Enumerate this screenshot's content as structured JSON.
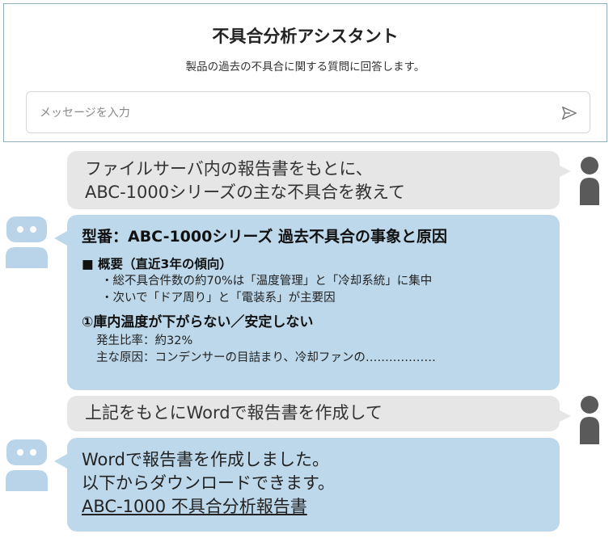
{
  "header": {
    "title": "不具合分析アシスタント",
    "subtitle": "製品の過去の不具合に関する質問に回答します。"
  },
  "input": {
    "placeholder": "メッセージを入力",
    "value": ""
  },
  "icons": {
    "send": "send-icon",
    "user_avatar": "user-avatar-icon",
    "bot_avatar": "robot-avatar-icon"
  },
  "colors": {
    "user_bubble": "#e6e6e6",
    "bot_bubble": "#bcd8ea",
    "bot_avatar": "#b9d4e8",
    "user_avatar": "#5a5a5a",
    "header_border": "#8fb0b8"
  },
  "messages": {
    "user1": {
      "line1": "ファイルサーバ内の報告書をもとに、",
      "line2": "ABC-1000シリーズの主な不具合を教えて"
    },
    "bot1": {
      "title": "型番：ABC-1000シリーズ 過去不具合の事象と原因",
      "overview_heading": "■ 概要（直近3年の傾向）",
      "bullets": [
        "・総不具合件数の約70%は「温度管理」と「冷却系統」に集中",
        "・次いで「ドア周り」と「電装系」が主要因"
      ],
      "issue_heading": "①庫内温度が下がらない／安定しない",
      "rate": "発生比率：約32%",
      "cause": "主な原因：コンデンサーの目詰まり、冷却ファンの………………"
    },
    "user2": {
      "text": "上記をもとにWordで報告書を作成して"
    },
    "bot2": {
      "line1": "Wordで報告書を作成しました。",
      "line2": "以下からダウンロードできます。",
      "link": "ABC-1000 不具合分析報告書"
    }
  }
}
